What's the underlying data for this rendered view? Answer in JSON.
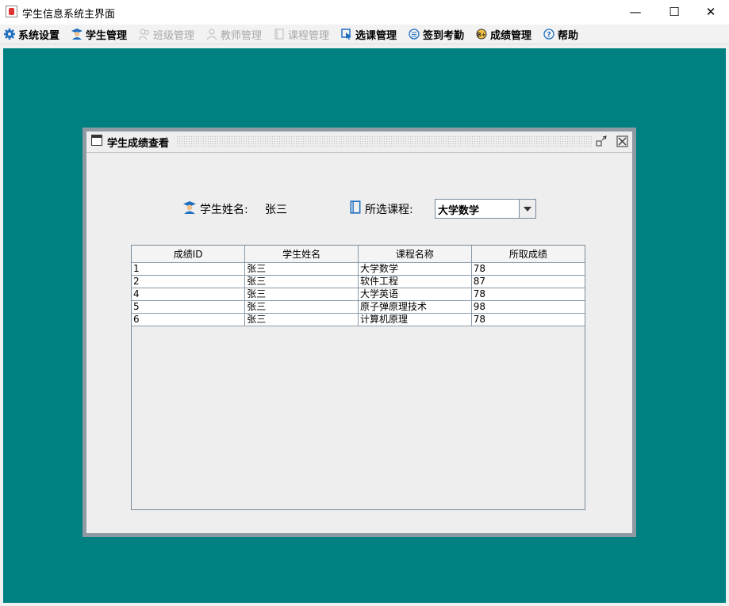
{
  "window": {
    "title": "学生信息系统主界面",
    "minimize": "—",
    "maximize": "☐",
    "close": "✕"
  },
  "menu": [
    {
      "label": "系统设置",
      "icon": "gear-icon",
      "enabled": true
    },
    {
      "label": "学生管理",
      "icon": "student-icon",
      "enabled": true
    },
    {
      "label": "班级管理",
      "icon": "class-icon",
      "enabled": false
    },
    {
      "label": "教师管理",
      "icon": "teacher-icon",
      "enabled": false
    },
    {
      "label": "课程管理",
      "icon": "course-icon",
      "enabled": false
    },
    {
      "label": "选课管理",
      "icon": "select-course-icon",
      "enabled": true
    },
    {
      "label": "签到考勤",
      "icon": "attendance-icon",
      "enabled": true
    },
    {
      "label": "成绩管理",
      "icon": "score-icon",
      "enabled": true
    },
    {
      "label": "帮助",
      "icon": "help-icon",
      "enabled": true
    }
  ],
  "internal_frame": {
    "title": "学生成绩查看",
    "student_name_label": "学生姓名:",
    "student_name_value": "张三",
    "course_label": "所选课程:",
    "course_selected": "大学数学"
  },
  "table": {
    "columns": [
      "成绩ID",
      "学生姓名",
      "课程名称",
      "所取成绩"
    ],
    "rows": [
      [
        "1",
        "张三",
        "大学数学",
        "78"
      ],
      [
        "2",
        "张三",
        "软件工程",
        "87"
      ],
      [
        "4",
        "张三",
        "大学英语",
        "78"
      ],
      [
        "5",
        "张三",
        "原子弹原理技术",
        "98"
      ],
      [
        "6",
        "张三",
        "计算机原理",
        "78"
      ]
    ]
  },
  "colors": {
    "desktop": "#008080",
    "accent_icon": "#1e6fc0"
  }
}
